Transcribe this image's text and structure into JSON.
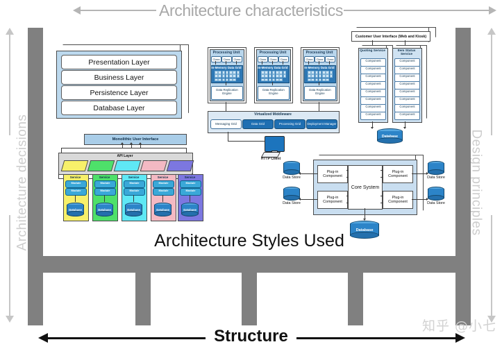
{
  "axes": {
    "top_label": "Architecture characteristics",
    "left_label": "Architecture decisions",
    "right_label": "Design principles",
    "bottom_label": "Structure"
  },
  "main_title": "Architecture Styles Used",
  "watermark": "知乎 @小七",
  "colors": {
    "frame_gray": "#808080",
    "axis_gray": "#c6c6c6",
    "panel_blue": "#bcd9ee",
    "db_blue": "#2c84c8",
    "accent_dark_blue": "#2e78b5"
  },
  "layered": {
    "layers": [
      {
        "label": "Presentation Layer"
      },
      {
        "label": "Business Layer"
      },
      {
        "label": "Persistence Layer"
      },
      {
        "label": "Database Layer"
      }
    ]
  },
  "space_based": {
    "processing_units": [
      {
        "title": "Processing Unit",
        "classes": [
          "Class",
          "Class",
          "Class"
        ],
        "grid": "In-Memory Data Grid",
        "cache": "Cache",
        "engine": "Data Replication Engine"
      },
      {
        "title": "Processing Unit",
        "classes": [
          "Class",
          "Class",
          "Class"
        ],
        "grid": "In-Memory Data Grid",
        "cache": "Cache",
        "engine": "Data Replication Engine"
      },
      {
        "title": "Processing Unit",
        "classes": [
          "Class",
          "Class",
          "Class"
        ],
        "grid": "In-Memory Data Grid",
        "cache": "Cache",
        "engine": "Data Replication Engine"
      }
    ],
    "middleware": {
      "title": "Virtualized Middleware",
      "pills": [
        {
          "label": "Messaging Grid",
          "fill": "#ffffff",
          "text": "#10354f"
        },
        {
          "label": "Data Grid",
          "fill": "#1f6fb2",
          "text": "#ffffff"
        },
        {
          "label": "Processing Grid",
          "fill": "#1f6fb2",
          "text": "#ffffff"
        },
        {
          "label": "Deployment Manager",
          "fill": "#1f6fb2",
          "text": "#ffffff"
        }
      ]
    }
  },
  "microservices": {
    "user_interface": "Customer User Interface (Web and Kiosk)",
    "services": [
      {
        "name": "Quoting Service",
        "components": [
          "Component",
          "Component",
          "Component",
          "Component",
          "Component",
          "Component",
          "Component",
          "Component"
        ]
      },
      {
        "name": "Item Status Service",
        "components": [
          "Component",
          "Component",
          "Component",
          "Component",
          "Component",
          "Component",
          "Component",
          "Component"
        ]
      }
    ],
    "database": "Database"
  },
  "service_based": {
    "user_interface": "Monolithic User Interface",
    "api_layer": "API Layer",
    "services": [
      {
        "title": "Service",
        "modules": [
          "Module",
          "Module"
        ],
        "database": "Database",
        "color": "#f7f06a"
      },
      {
        "title": "Service",
        "modules": [
          "Module",
          "Module"
        ],
        "database": "Database",
        "color": "#4ee06a"
      },
      {
        "title": "Service",
        "modules": [
          "Module",
          "Module"
        ],
        "database": "Database",
        "color": "#5fe8f5"
      },
      {
        "title": "Service",
        "modules": [
          "Module",
          "Module"
        ],
        "database": "Database",
        "color": "#f3b9c3"
      },
      {
        "title": "Service",
        "modules": [
          "Module",
          "Module"
        ],
        "database": "Database",
        "color": "#7c77e0"
      }
    ]
  },
  "microkernel": {
    "http_client": "HTTP Client",
    "core": "Core System",
    "plugins": [
      {
        "label": "Plug-in Component"
      },
      {
        "label": "Plug-in Component"
      },
      {
        "label": "Plug-in Component"
      },
      {
        "label": "Plug-in Component"
      }
    ],
    "data_stores": [
      {
        "label": "Data Store"
      },
      {
        "label": "Data Store"
      },
      {
        "label": "Data Store"
      },
      {
        "label": "Data Store"
      }
    ],
    "database": "Database"
  }
}
